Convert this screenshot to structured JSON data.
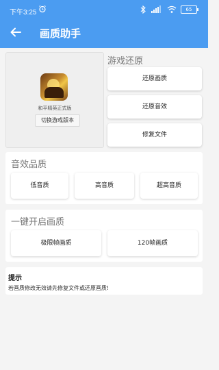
{
  "status": {
    "time": "下午3:25",
    "battery": "65"
  },
  "header": {
    "title": "画质助手"
  },
  "game": {
    "name": "和平精英正式版",
    "switch_label": "切换游戏版本"
  },
  "restore": {
    "title": "游戏还原",
    "buttons": [
      "还原画质",
      "还原音效",
      "修复文件"
    ]
  },
  "sound": {
    "title": "音效品质",
    "buttons": [
      "低音质",
      "高音质",
      "超高音质"
    ]
  },
  "quality": {
    "title": "一键开启画质",
    "buttons": [
      "极限帧画质",
      "120帧画质"
    ]
  },
  "tip": {
    "title": "提示",
    "text": "若画质修改无效请先修复文件或还原画质!"
  },
  "colors": {
    "header": "#4b9cf1",
    "background": "#f4f4f4"
  }
}
